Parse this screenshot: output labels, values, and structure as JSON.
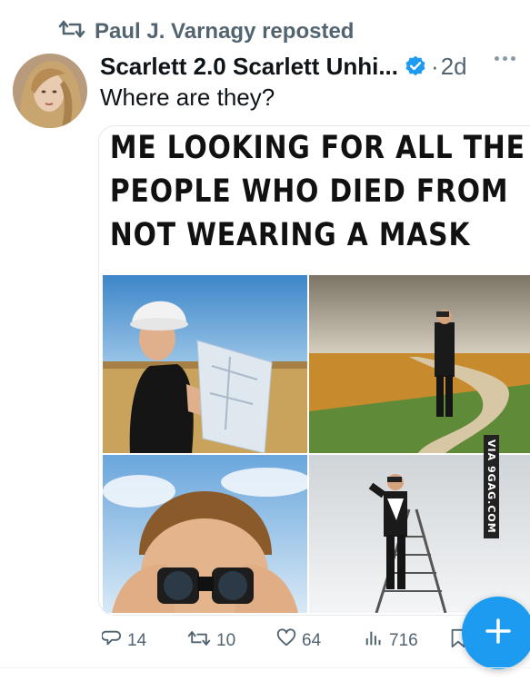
{
  "repost": {
    "text": "Paul J. Varnagy reposted",
    "icon": "repost-icon"
  },
  "author": {
    "name": "Scarlett 2.0 Scarlett Unhi...",
    "verified": true,
    "time": "2d"
  },
  "tweet": {
    "text": "Where are they?"
  },
  "media": {
    "caption_lines": [
      "ME LOOKING FOR ALL THE",
      "PEOPLE WHO DIED FROM",
      "NOT WEARING A MASK"
    ],
    "watermark": "VIA 9GAG.COM"
  },
  "actions": {
    "replies": "14",
    "reposts": "10",
    "likes": "64",
    "views": "716"
  },
  "colors": {
    "accent": "#1d9bf0",
    "muted": "#536471",
    "text": "#0f1419"
  }
}
